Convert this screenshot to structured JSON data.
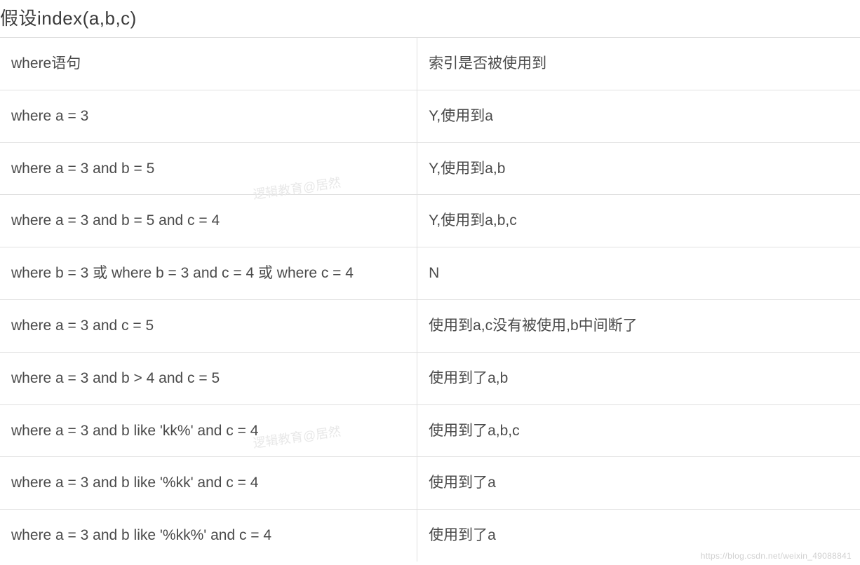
{
  "title": "假设index(a,b,c)",
  "table": {
    "header": {
      "col1": "where语句",
      "col2": "索引是否被使用到"
    },
    "rows": [
      {
        "col1": "where a = 3",
        "col2": "Y,使用到a"
      },
      {
        "col1": "where a = 3 and b = 5",
        "col2": "Y,使用到a,b"
      },
      {
        "col1": "where a = 3 and b = 5 and c = 4",
        "col2": "Y,使用到a,b,c"
      },
      {
        "col1": "where b = 3 或 where b = 3 and c = 4 或 where c = 4",
        "col2": "N"
      },
      {
        "col1": "where a = 3 and c = 5",
        "col2": "使用到a,c没有被使用,b中间断了"
      },
      {
        "col1": "where a = 3 and b > 4 and c = 5",
        "col2": "使用到了a,b"
      },
      {
        "col1": "where a = 3 and b like 'kk%' and c = 4",
        "col2": "使用到了a,b,c"
      },
      {
        "col1": "where a = 3 and b like '%kk' and c = 4",
        "col2": "使用到了a"
      },
      {
        "col1": "where a = 3 and b like '%kk%' and c = 4",
        "col2": "使用到了a"
      }
    ]
  },
  "watermark": "https://blog.csdn.net/weixin_49088841",
  "faint_mark": "逻辑教育@居然"
}
